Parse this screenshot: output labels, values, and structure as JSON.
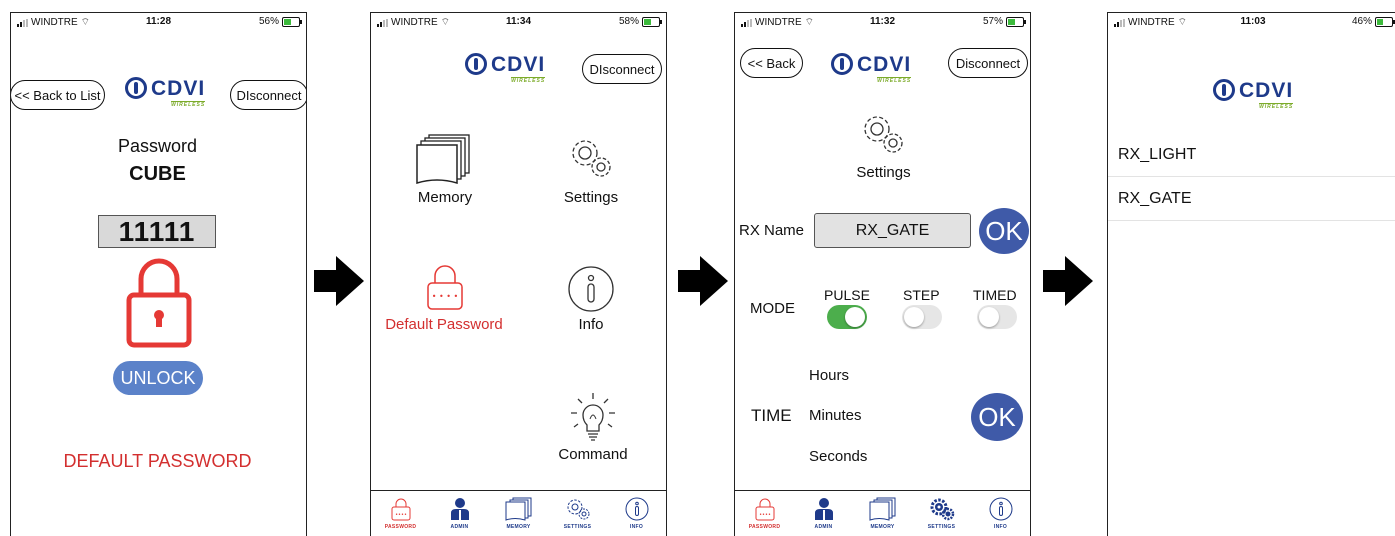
{
  "screen1": {
    "status": {
      "carrier": "WINDTRE",
      "time": "11:28",
      "battery": "56%",
      "battery_level": 0.56
    },
    "back_label": "<< Back to List",
    "disconnect_label": "DIsconnect",
    "logo": {
      "word": "CDVI",
      "sub": "WIRELESS"
    },
    "password_label": "Password",
    "device_name": "CUBE",
    "password_value": "11111",
    "unlock_label": "UNLOCK",
    "default_password_label": "DEFAULT PASSWORD"
  },
  "screen2": {
    "status": {
      "carrier": "WINDTRE",
      "time": "11:34",
      "battery": "58%",
      "battery_level": 0.58
    },
    "disconnect_label": "DIsconnect",
    "logo": {
      "word": "CDVI",
      "sub": "WIRELESS"
    },
    "menu": {
      "memory": "Memory",
      "settings": "Settings",
      "default_password": "Default Password",
      "info": "Info",
      "command": "Command"
    },
    "tabs": [
      "PASSWORD",
      "ADMIN",
      "MEMORY",
      "SETTINGS",
      "INFO"
    ]
  },
  "screen3": {
    "status": {
      "carrier": "WINDTRE",
      "time": "11:32",
      "battery": "57%",
      "battery_level": 0.57
    },
    "back_label": "<< Back",
    "disconnect_label": "Disconnect",
    "logo": {
      "word": "CDVI",
      "sub": "WIRELESS"
    },
    "settings_label": "Settings",
    "rx_name_label": "RX Name",
    "rx_name_value": "RX_GATE",
    "ok_label": "OK",
    "mode_label": "MODE",
    "modes": [
      {
        "label": "PULSE",
        "on": true
      },
      {
        "label": "STEP",
        "on": false
      },
      {
        "label": "TIMED",
        "on": false
      }
    ],
    "time_label": "TIME",
    "time_units": [
      "Hours",
      "Minutes",
      "Seconds"
    ],
    "tabs": [
      "PASSWORD",
      "ADMIN",
      "MEMORY",
      "SETTINGS",
      "INFO"
    ]
  },
  "screen4": {
    "status": {
      "carrier": "WINDTRE",
      "time": "11:03",
      "battery": "46%",
      "battery_level": 0.46
    },
    "logo": {
      "word": "CDVI",
      "sub": "WIRELESS"
    },
    "devices": [
      "RX_LIGHT",
      "RX_GATE"
    ]
  },
  "colors": {
    "brand": "#1e3a8a",
    "accent_red": "#d32f2f",
    "ok_blue": "#3f5aa8",
    "toggle_on": "#4cae4c",
    "unlock_blue": "#5b82c9"
  }
}
